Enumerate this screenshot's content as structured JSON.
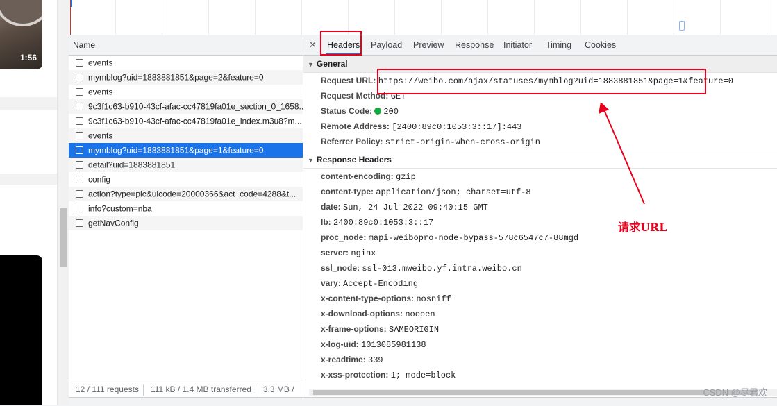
{
  "left_page": {
    "video_duration": "1:56"
  },
  "request_list": {
    "column_name": "Name",
    "rows": [
      {
        "name": "events"
      },
      {
        "name": "mymblog?uid=1883881851&page=2&feature=0"
      },
      {
        "name": "events"
      },
      {
        "name": "9c3f1c63-b910-43cf-afac-cc47819fa01e_section_0_1658..."
      },
      {
        "name": "9c3f1c63-b910-43cf-afac-cc47819fa01e_index.m3u8?m..."
      },
      {
        "name": "events"
      },
      {
        "name": "mymblog?uid=1883881851&page=1&feature=0",
        "selected": true
      },
      {
        "name": "detail?uid=1883881851"
      },
      {
        "name": "config"
      },
      {
        "name": "action?type=pic&uicode=20000366&act_code=4288&t..."
      },
      {
        "name": "info?custom=nba"
      },
      {
        "name": "getNavConfig"
      }
    ],
    "status": {
      "requests": "12 / 111 requests",
      "transferred": "111 kB / 1.4 MB transferred",
      "resources": "3.3 MB /"
    }
  },
  "tabs": [
    "Headers",
    "Payload",
    "Preview",
    "Response",
    "Initiator",
    "Timing",
    "Cookies"
  ],
  "active_tab": "Headers",
  "general": {
    "title": "General",
    "fields": [
      {
        "key": "Request URL:",
        "value": "https://weibo.com/ajax/statuses/mymblog?uid=1883881851&page=1&feature=0"
      },
      {
        "key": "Request Method:",
        "value": "GET"
      },
      {
        "key": "Status Code:",
        "value": "200",
        "status_color": "#0caa41"
      },
      {
        "key": "Remote Address:",
        "value": "[2400:89c0:1053:3::17]:443"
      },
      {
        "key": "Referrer Policy:",
        "value": "strict-origin-when-cross-origin"
      }
    ]
  },
  "response_headers": {
    "title": "Response Headers",
    "fields": [
      {
        "key": "content-encoding:",
        "value": "gzip"
      },
      {
        "key": "content-type:",
        "value": "application/json; charset=utf-8"
      },
      {
        "key": "date:",
        "value": "Sun, 24 Jul 2022 09:40:15 GMT"
      },
      {
        "key": "lb:",
        "value": "2400:89c0:1053:3::17"
      },
      {
        "key": "proc_node:",
        "value": "mapi-weibopro-node-bypass-578c6547c7-88mgd"
      },
      {
        "key": "server:",
        "value": "nginx"
      },
      {
        "key": "ssl_node:",
        "value": "ssl-013.mweibo.yf.intra.weibo.cn"
      },
      {
        "key": "vary:",
        "value": "Accept-Encoding"
      },
      {
        "key": "x-content-type-options:",
        "value": "nosniff"
      },
      {
        "key": "x-download-options:",
        "value": "noopen"
      },
      {
        "key": "x-frame-options:",
        "value": "SAMEORIGIN"
      },
      {
        "key": "x-log-uid:",
        "value": "1013085981138"
      },
      {
        "key": "x-readtime:",
        "value": "339"
      },
      {
        "key": "x-xss-protection:",
        "value": "1; mode=block"
      }
    ]
  },
  "annotation": {
    "text": "请求URL",
    "color": "#e8001c"
  },
  "watermark": "CSDN @尽君欢",
  "colors": {
    "selected_row": "#1a73e8",
    "highlight": "#e8001c"
  }
}
